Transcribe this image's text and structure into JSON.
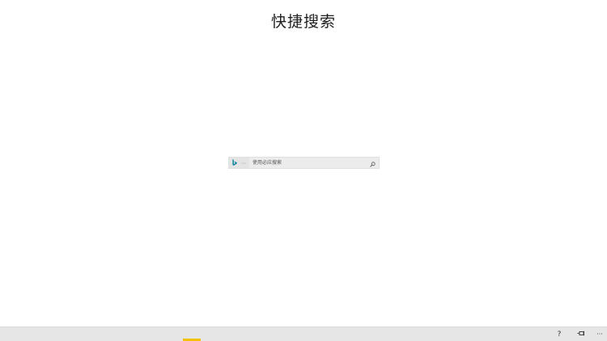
{
  "page": {
    "title": "快捷搜索"
  },
  "search": {
    "engine_icon": "bing-logo-icon",
    "dropdown_icon": "ellipsis-icon",
    "placeholder": "使用必应搜索",
    "value": "",
    "search_icon": "search-icon"
  },
  "taskbar": {
    "help_label": "?",
    "pin_icon": "pin-icon",
    "more_label": "···"
  },
  "colors": {
    "background": "#ffffff",
    "search_box_bg": "#ececec",
    "bing_teal": "#00809d",
    "taskbar_bg": "#e6e6e6",
    "accent": "#f2c200"
  }
}
